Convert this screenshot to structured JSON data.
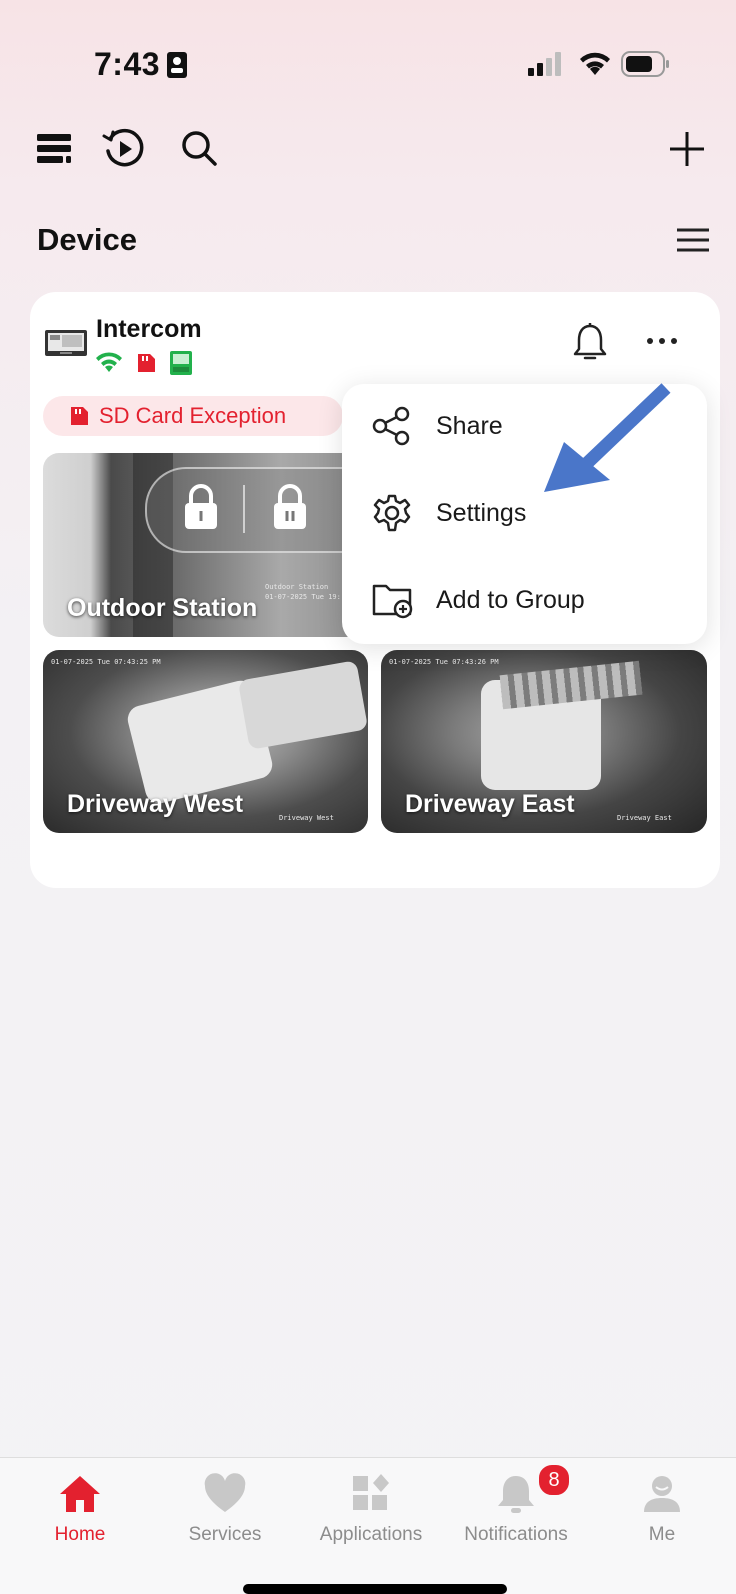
{
  "status_bar": {
    "time": "7:43"
  },
  "header": {
    "section_title": "Device"
  },
  "device": {
    "name": "Intercom",
    "alert": "SD Card Exception",
    "cameras": [
      {
        "label": "Outdoor Station",
        "osd_name": "Outdoor Station",
        "osd_time": "01-07-2025 Tue 19:"
      },
      {
        "label": "Driveway West",
        "osd_name": "Driveway West",
        "osd_time": "01-07-2025 Tue 07:43:25 PM"
      },
      {
        "label": "Driveway East",
        "osd_name": "Driveway East",
        "osd_time": "01-07-2025 Tue 07:43:26 PM"
      }
    ]
  },
  "menu": {
    "items": [
      {
        "label": "Share"
      },
      {
        "label": "Settings"
      },
      {
        "label": "Add to Group"
      }
    ]
  },
  "tabbar": {
    "tabs": [
      {
        "label": "Home",
        "icon": "home-icon"
      },
      {
        "label": "Services",
        "icon": "heart-icon"
      },
      {
        "label": "Applications",
        "icon": "applications-icon"
      },
      {
        "label": "Notifications",
        "icon": "bell-icon"
      },
      {
        "label": "Me",
        "icon": "person-icon"
      }
    ],
    "notification_count": "8"
  },
  "colors": {
    "accent_red": "#e3212f",
    "annotation_arrow": "#4a76c9",
    "status_green": "#22b14c"
  }
}
